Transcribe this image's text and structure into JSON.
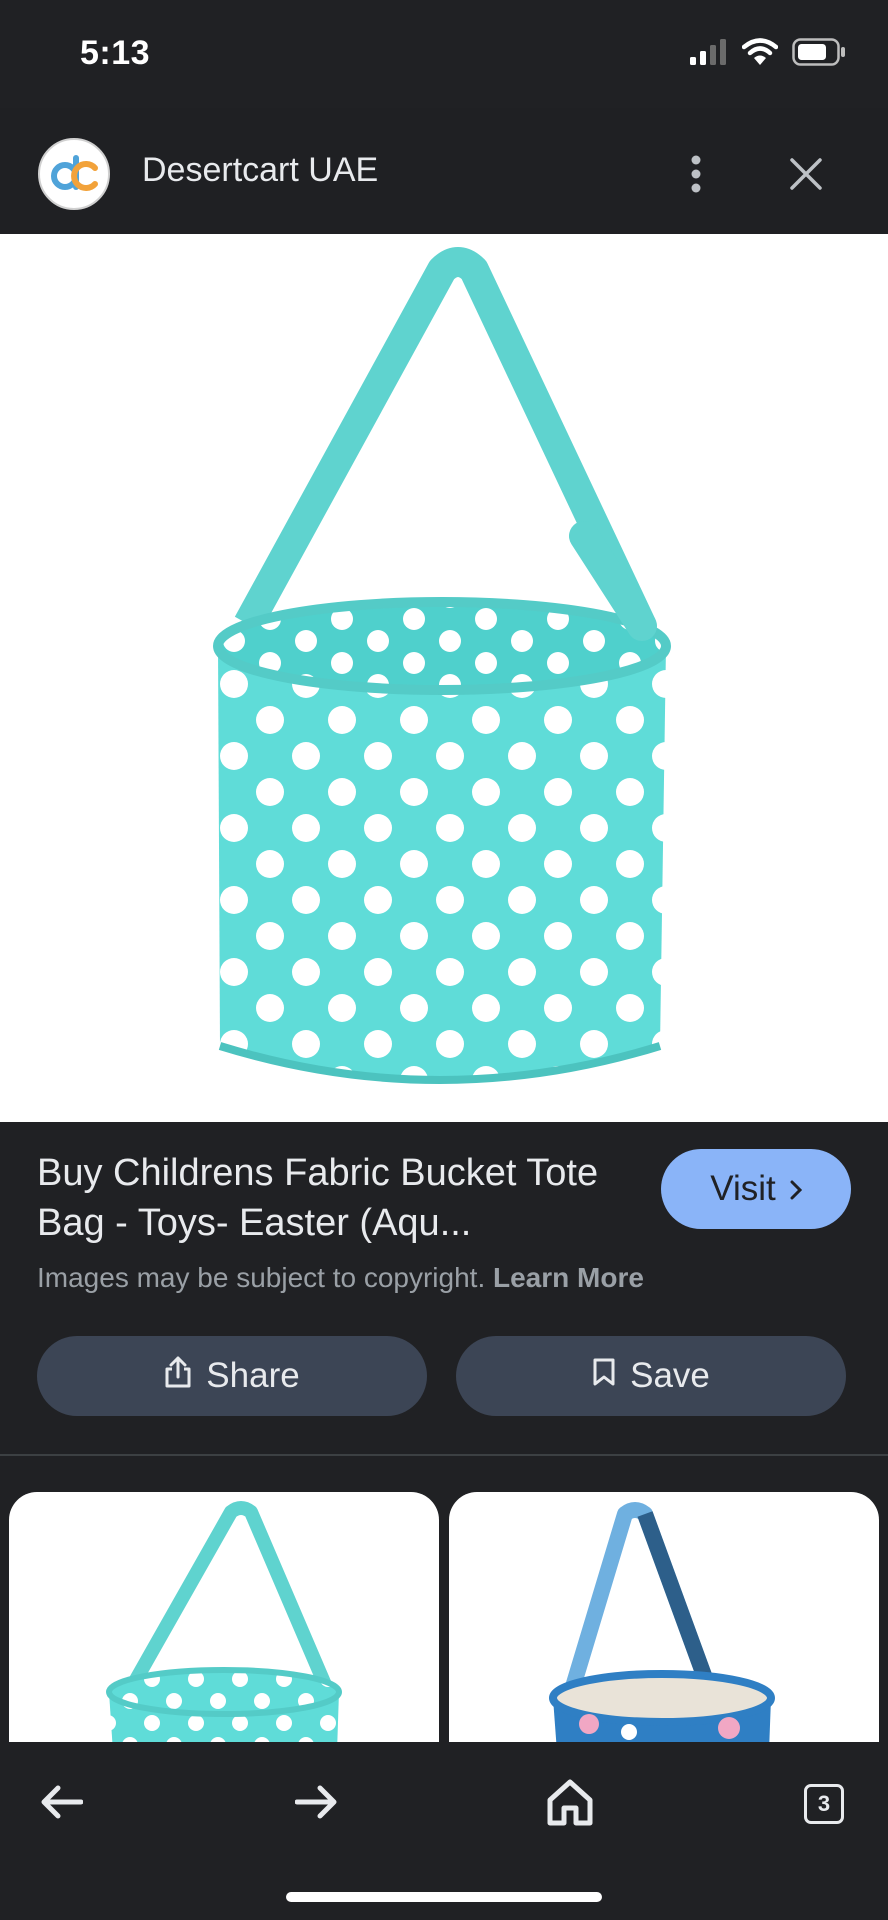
{
  "status_bar": {
    "time": "5:13"
  },
  "header": {
    "site_name": "Desertcart UAE"
  },
  "result": {
    "title": "Buy Childrens Fabric Bucket Tote Bag - Toys- Easter (Aqu...",
    "visit_label": "Visit",
    "copyright_text": "Images may be subject to copyright.",
    "learn_more_label": "Learn More"
  },
  "actions": {
    "share_label": "Share",
    "save_label": "Save"
  },
  "bottom_nav": {
    "tabs_count": "3"
  },
  "colors": {
    "background": "#202124",
    "visit_button": "#8ab4f8",
    "action_button": "#3c4555",
    "bag_aqua": "#5fdcd8",
    "bag_blue": "#2f7fc4"
  },
  "icons": [
    "cellular-signal-icon",
    "wifi-icon",
    "battery-icon",
    "site-logo",
    "more-vert-icon",
    "close-icon",
    "chevron-right-icon",
    "share-icon",
    "bookmark-icon",
    "back-arrow-icon",
    "forward-arrow-icon",
    "home-icon",
    "tabs-icon"
  ]
}
